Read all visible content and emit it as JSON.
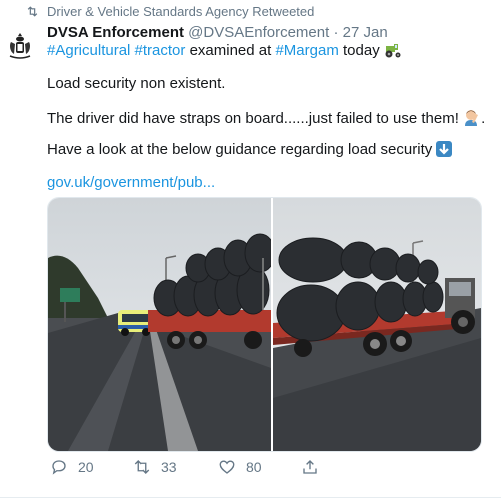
{
  "retweet": {
    "text": "Driver & Vehicle Standards Agency Retweeted",
    "icon": "retweet-icon"
  },
  "tweet": {
    "author_name": "DVSA Enforcement",
    "handle": "@DVSAEnforcement",
    "separator": "·",
    "date": "27 Jan",
    "line1": {
      "hashtag1": "#Agricultural",
      "hashtag2": "#tractor",
      "middle": " examined at ",
      "hashtag3": "#Margam",
      "end": " today "
    },
    "line2": "Load security non existent.",
    "line3": "The driver did have straps on board......just failed to use them! ",
    "line3_end": ".",
    "line4": "Have a look at the below guidance regarding load security ",
    "link": "gov.uk/government/pub...",
    "emojis": [
      "tractor-emoji",
      "man-facepalming-emoji",
      "down-arrow-emoji"
    ]
  },
  "actions": {
    "reply_count": "20",
    "retweet_count": "33",
    "like_count": "80"
  },
  "colors": {
    "link": "#1b95e0",
    "muted": "#657786",
    "text": "#14171a"
  }
}
